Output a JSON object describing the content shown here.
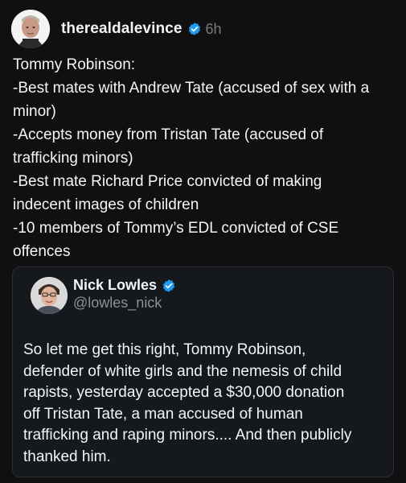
{
  "post": {
    "author": {
      "username": "therealdalevince",
      "verified_icon": "verified-badge-icon",
      "time": "6h"
    },
    "text_lines": [
      "Tommy Robinson:",
      "-Best mates with Andrew Tate (accused of sex with a",
      "minor)",
      "-Accepts money from Tristan Tate (accused of",
      "trafficking minors)",
      "-Best mate Richard Price convicted of making",
      "indecent images of children",
      "-10 members of Tommy’s EDL convicted of CSE",
      "offences"
    ],
    "quoted": {
      "name": "Nick Lowles",
      "handle": "@lowles_nick",
      "text_lines": [
        "So let me get this right, Tommy Robinson,",
        "defender of white girls and the nemesis of child",
        "rapists, yesterday accepted a $30,000 donation",
        "off Tristan Tate, a man accused of human",
        "trafficking and raping minors.... And then publicly",
        "thanked him."
      ]
    }
  },
  "colors": {
    "background": "#101010",
    "text": "#f3f5f7",
    "muted": "#7a7a7a",
    "verified": "#1d9bf0",
    "quote_border": "#2a2d33"
  }
}
